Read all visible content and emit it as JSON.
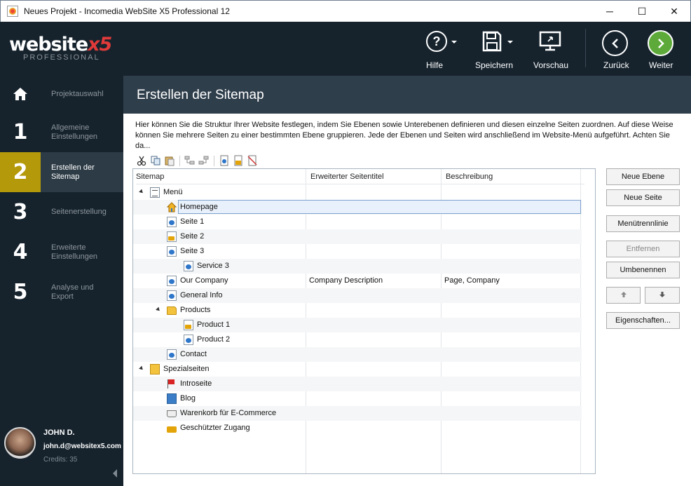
{
  "window": {
    "title": "Neues Projekt - Incomedia WebSite X5 Professional 12",
    "minimize": "─",
    "maximize": "☐",
    "close": "✕"
  },
  "logo": {
    "brand": "website",
    "brand_x5": "x5",
    "edition": "PROFESSIONAL"
  },
  "sidebar": {
    "items": [
      {
        "num": "",
        "label": "Projektauswahl",
        "icon": "home-icon"
      },
      {
        "num": "1",
        "label": "Allgemeine Einstellungen"
      },
      {
        "num": "2",
        "label": "Erstellen der Sitemap"
      },
      {
        "num": "3",
        "label": "Seitenerstellung"
      },
      {
        "num": "4",
        "label": "Erweiterte Einstellungen"
      },
      {
        "num": "5",
        "label": "Analyse und Export"
      }
    ],
    "active_index": 2,
    "active_color": "#b49a0a"
  },
  "user": {
    "name": "JOHN D.",
    "email": "john.d@websitex5.com",
    "credits": "Credits: 35"
  },
  "toolbar": {
    "help": "Hilfe",
    "save": "Speichern",
    "preview": "Vorschau",
    "back": "Zurück",
    "next": "Weiter",
    "next_color": "#5daa3a"
  },
  "header": {
    "title": "Erstellen der Sitemap"
  },
  "description": "Hier können Sie die Struktur Ihrer Website festlegen, indem Sie Ebenen sowie Unterebenen definieren und diesen einzelne Seiten zuordnen. Auf diese Weise können Sie mehrere Seiten zu einer bestimmten Ebene gruppieren. Jede der Ebenen und Seiten wird anschließend im Website-Menü aufgeführt. Achten Sie da...",
  "tree": {
    "columns": [
      "Sitemap",
      "Erweiterter Seitentitel",
      "Beschreibung"
    ],
    "rows": [
      {
        "label": "Menü",
        "icon": "menu-icon",
        "level": 0,
        "toggle": true,
        "c2": "",
        "c3": ""
      },
      {
        "label": "Homepage",
        "icon": "home-page-icon",
        "level": 1,
        "selected": true,
        "c2": "",
        "c3": ""
      },
      {
        "label": "Seite 1",
        "icon": "page-icon",
        "level": 1,
        "c2": "",
        "c3": ""
      },
      {
        "label": "Seite 2",
        "icon": "locked-page-icon",
        "level": 1,
        "c2": "",
        "c3": ""
      },
      {
        "label": "Seite 3",
        "icon": "page-icon",
        "level": 1,
        "c2": "",
        "c3": ""
      },
      {
        "label": "Service 3",
        "icon": "page-icon",
        "level": 2,
        "c2": "",
        "c3": ""
      },
      {
        "label": "Our Company",
        "icon": "page-icon",
        "level": 1,
        "c2": "Company Description",
        "c3": "Page, Company"
      },
      {
        "label": "General Info",
        "icon": "page-icon",
        "level": 1,
        "c2": "",
        "c3": ""
      },
      {
        "label": "Products",
        "icon": "folder-icon",
        "level": 1,
        "toggle": true,
        "c2": "",
        "c3": ""
      },
      {
        "label": "Product 1",
        "icon": "locked-page-icon",
        "level": 2,
        "c2": "",
        "c3": ""
      },
      {
        "label": "Product 2",
        "icon": "page-icon",
        "level": 2,
        "c2": "",
        "c3": ""
      },
      {
        "label": "Contact",
        "icon": "page-icon",
        "level": 1,
        "c2": "",
        "c3": ""
      },
      {
        "label": "Spezialseiten",
        "icon": "special-pages-icon",
        "level": 0,
        "toggle": true,
        "c2": "",
        "c3": ""
      },
      {
        "label": "Introseite",
        "icon": "flag-icon",
        "level": 1,
        "c2": "",
        "c3": ""
      },
      {
        "label": "Blog",
        "icon": "blog-icon",
        "level": 1,
        "c2": "",
        "c3": ""
      },
      {
        "label": "Warenkorb für E-Commerce",
        "icon": "cart-icon",
        "level": 1,
        "c2": "",
        "c3": ""
      },
      {
        "label": "Geschützter Zugang",
        "icon": "lock-icon",
        "level": 1,
        "c2": "",
        "c3": ""
      }
    ]
  },
  "buttons": {
    "new_level": "Neue Ebene",
    "new_page": "Neue Seite",
    "menu_separator": "Menütrennlinie",
    "remove": "Entfernen",
    "rename": "Umbenennen",
    "move_up": "🡅",
    "move_down": "🡇",
    "properties": "Eigenschaften..."
  }
}
